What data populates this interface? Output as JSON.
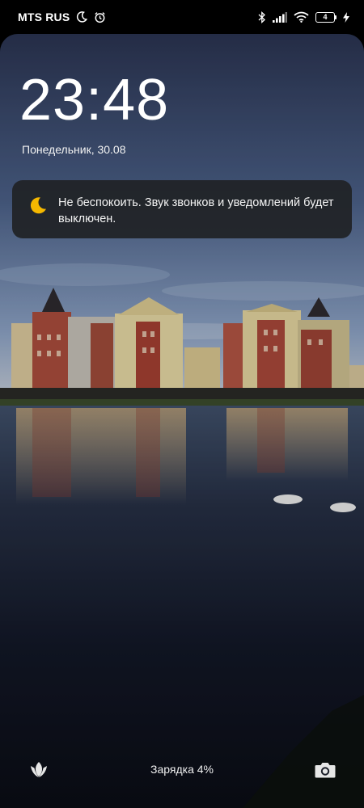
{
  "status_bar": {
    "carrier": "MTS RUS",
    "battery_level": "4",
    "icons": [
      "moon-icon",
      "alarm-icon",
      "bluetooth-icon",
      "signal-icon",
      "wifi-icon",
      "battery-icon",
      "charging-bolt-icon"
    ]
  },
  "lock_screen": {
    "time": "23:48",
    "date": "Понедельник, 30.08"
  },
  "notification": {
    "icon": "moon-icon",
    "icon_color": "#f5b800",
    "text": "Не беспокоить. Звук звонков и уведомлений будет выключен."
  },
  "bottom": {
    "left_icon": "tulip-icon",
    "charging_text": "Зарядка 4%",
    "right_icon": "camera-icon"
  }
}
